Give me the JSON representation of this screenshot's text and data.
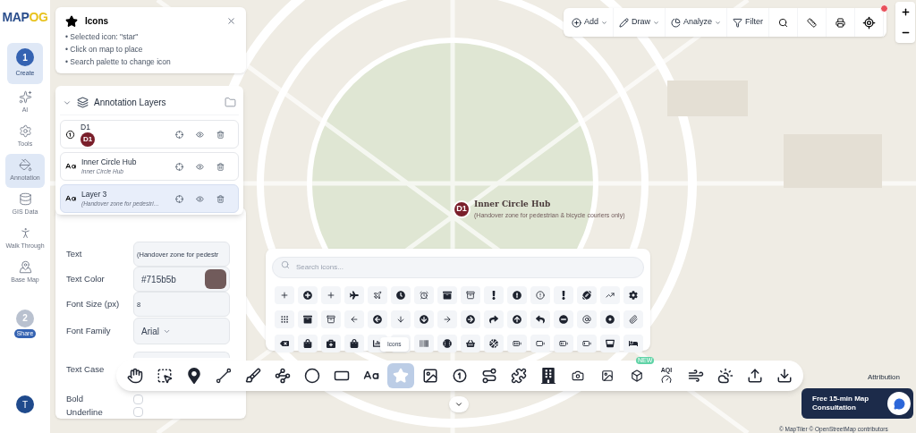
{
  "logo": {
    "primary": "MAP",
    "accent": "OG"
  },
  "steps": [
    {
      "number": "1",
      "label": "Create",
      "selected": true
    },
    {
      "number": "2",
      "label": "Share",
      "selected": false
    }
  ],
  "nav": [
    {
      "label": "AI",
      "selected": false
    },
    {
      "label": "Tools",
      "selected": false
    },
    {
      "label": "Annotation",
      "selected": true
    },
    {
      "label": "GIS Data",
      "selected": false
    },
    {
      "label": "Walk Through",
      "selected": false
    },
    {
      "label": "Base Map",
      "selected": false
    }
  ],
  "user": {
    "initial": "T"
  },
  "info_popup": {
    "title": "Icons",
    "lines": [
      "• Selected icon: \"star\"",
      "• Click on map to place",
      "• Search palette to change icon"
    ]
  },
  "layers_panel": {
    "title": "Annotation Layers",
    "expanded": true,
    "layers": [
      {
        "kind": "number",
        "name": "D1",
        "badge": "D1",
        "selected": false
      },
      {
        "kind": "text",
        "name": "Inner Circle Hub",
        "subtitle": "Inner Circle Hub",
        "selected": false
      },
      {
        "kind": "text",
        "name": "Layer 3",
        "subtitle": "(Handover zone for pedestri…",
        "selected": true
      }
    ]
  },
  "properties": {
    "fields": [
      {
        "kind": "input",
        "label": "Text",
        "value": "(Handover zone for pedestr"
      },
      {
        "kind": "color",
        "label": "Text Color",
        "value": "#715b5b",
        "color": "#715b5b"
      },
      {
        "kind": "input",
        "label": "Font Size (px)",
        "value": "8"
      },
      {
        "kind": "select",
        "label": "Font Family",
        "value": "Arial"
      },
      {
        "kind": "covered",
        "label": "Text Case"
      },
      {
        "kind": "checkbox",
        "label": "Bold",
        "checked": false
      },
      {
        "kind": "checkbox",
        "label": "Underline",
        "checked": false
      }
    ]
  },
  "top_toolbar": {
    "menus": [
      {
        "label": "Add",
        "dropdown": true
      },
      {
        "label": "Draw",
        "dropdown": true
      },
      {
        "label": "Analyze",
        "dropdown": true
      },
      {
        "label": "Filter",
        "dropdown": false
      }
    ]
  },
  "palette": {
    "placeholder": "Search icons...",
    "tooltip": "Icons"
  },
  "tools": [
    {
      "selected": false
    },
    {
      "selected": false
    },
    {
      "selected": false
    },
    {
      "selected": false
    },
    {
      "selected": false
    },
    {
      "selected": false
    },
    {
      "selected": false
    },
    {
      "selected": false
    },
    {
      "selected": false
    },
    {
      "selected": true
    },
    {
      "selected": false
    },
    {
      "selected": false
    },
    {
      "selected": false
    },
    {
      "selected": false
    },
    {
      "selected": false
    },
    {
      "selected": false
    },
    {
      "selected": false
    },
    {
      "selected": false,
      "badge": "NEW"
    },
    {
      "selected": false,
      "label": "AQI"
    },
    {
      "selected": false
    },
    {
      "selected": false
    },
    {
      "selected": false
    },
    {
      "selected": false
    }
  ],
  "marker": {
    "badge": "D1",
    "title": "Inner Circle Hub",
    "subtitle": "(Handover zone for pedestrian & bicycle couriers only)"
  },
  "consult_button": {
    "label": "Free 15-min Map Consultation"
  },
  "attribution": {
    "label": "Attribution",
    "credits": "© MapTiler © OpenStreetMap contributors"
  }
}
